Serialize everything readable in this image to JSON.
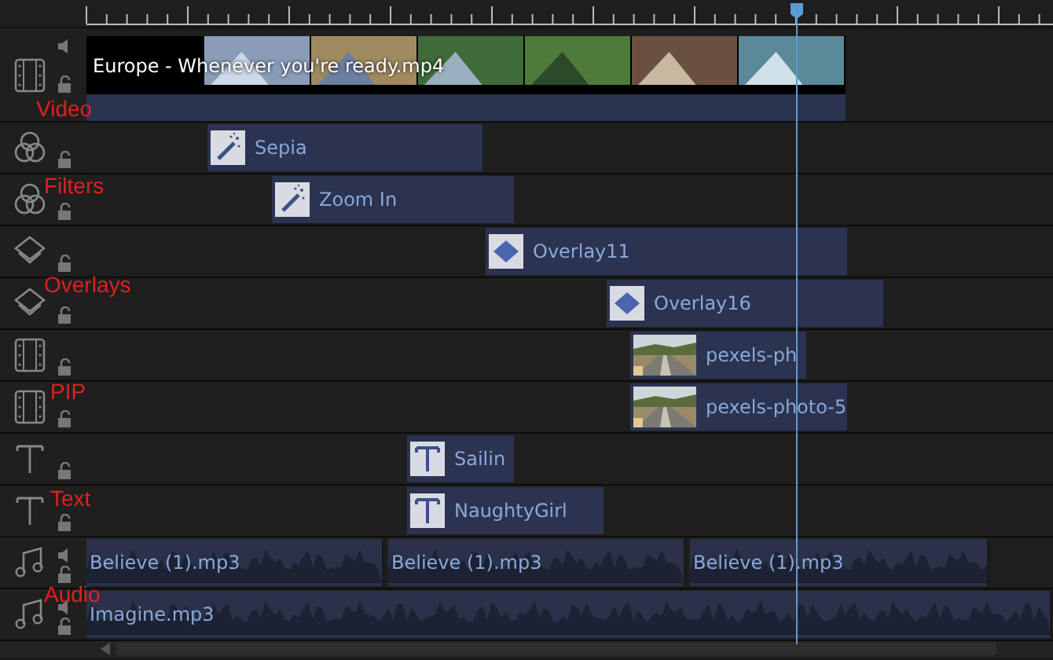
{
  "tracks": [
    {
      "kind": "video",
      "clips": [
        {
          "label": "Europe - Whenever you're ready.mp4",
          "kind": "filmstrip"
        }
      ]
    },
    {
      "kind": "filter",
      "clips": [
        {
          "label": "Sepia",
          "kind": "wand"
        }
      ]
    },
    {
      "kind": "filter",
      "clips": [
        {
          "label": "Zoom In",
          "kind": "wand"
        }
      ]
    },
    {
      "kind": "overlay",
      "clips": [
        {
          "label": "Overlay11",
          "kind": "diamond"
        }
      ]
    },
    {
      "kind": "overlay",
      "clips": [
        {
          "label": "Overlay16",
          "kind": "diamond"
        }
      ]
    },
    {
      "kind": "pip",
      "clips": [
        {
          "label": "pexels-ph"
        }
      ]
    },
    {
      "kind": "pip",
      "clips": [
        {
          "label": "pexels-photo-5"
        }
      ]
    },
    {
      "kind": "text",
      "clips": [
        {
          "label": "Sailin",
          "kind": "type"
        }
      ]
    },
    {
      "kind": "text",
      "clips": [
        {
          "label": "NaughtyGirl",
          "kind": "type"
        }
      ]
    },
    {
      "kind": "audio",
      "clips": [
        {
          "label": "Believe (1).mp3",
          "kind": "waveform"
        },
        {
          "label": "Believe (1).mp3",
          "kind": "waveform"
        },
        {
          "label": "Believe (1).mp3",
          "kind": "waveform"
        }
      ]
    },
    {
      "kind": "audio",
      "clips": [
        {
          "label": "Imagine.mp3",
          "kind": "waveform"
        }
      ]
    }
  ],
  "annotations": [
    {
      "text": "Video"
    },
    {
      "text": "Filters"
    },
    {
      "text": "Overlays"
    },
    {
      "text": "PIP"
    },
    {
      "text": "Text"
    },
    {
      "text": "Audio"
    }
  ]
}
